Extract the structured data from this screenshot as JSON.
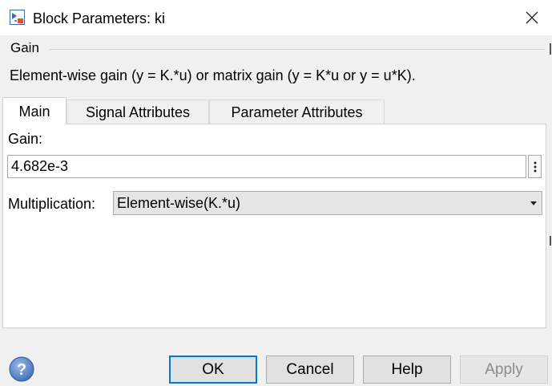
{
  "window": {
    "title": "Block Parameters: ki",
    "close_icon": "close-icon"
  },
  "group": {
    "title": "Gain",
    "description": "Element-wise gain (y = K.*u) or matrix gain (y = K*u or y = u*K)."
  },
  "tabs": [
    {
      "label": "Main",
      "active": true
    },
    {
      "label": "Signal Attributes",
      "active": false
    },
    {
      "label": "Parameter Attributes",
      "active": false
    }
  ],
  "main": {
    "gain_label": "Gain:",
    "gain_value": "4.682e-3",
    "multiplication_label": "Multiplication:",
    "multiplication_value": "Element-wise(K.*u)"
  },
  "buttons": {
    "ok": "OK",
    "cancel": "Cancel",
    "help": "Help",
    "apply": "Apply"
  },
  "colors": {
    "accent": "#0078d7",
    "help_icon": "#3e6fb6"
  }
}
